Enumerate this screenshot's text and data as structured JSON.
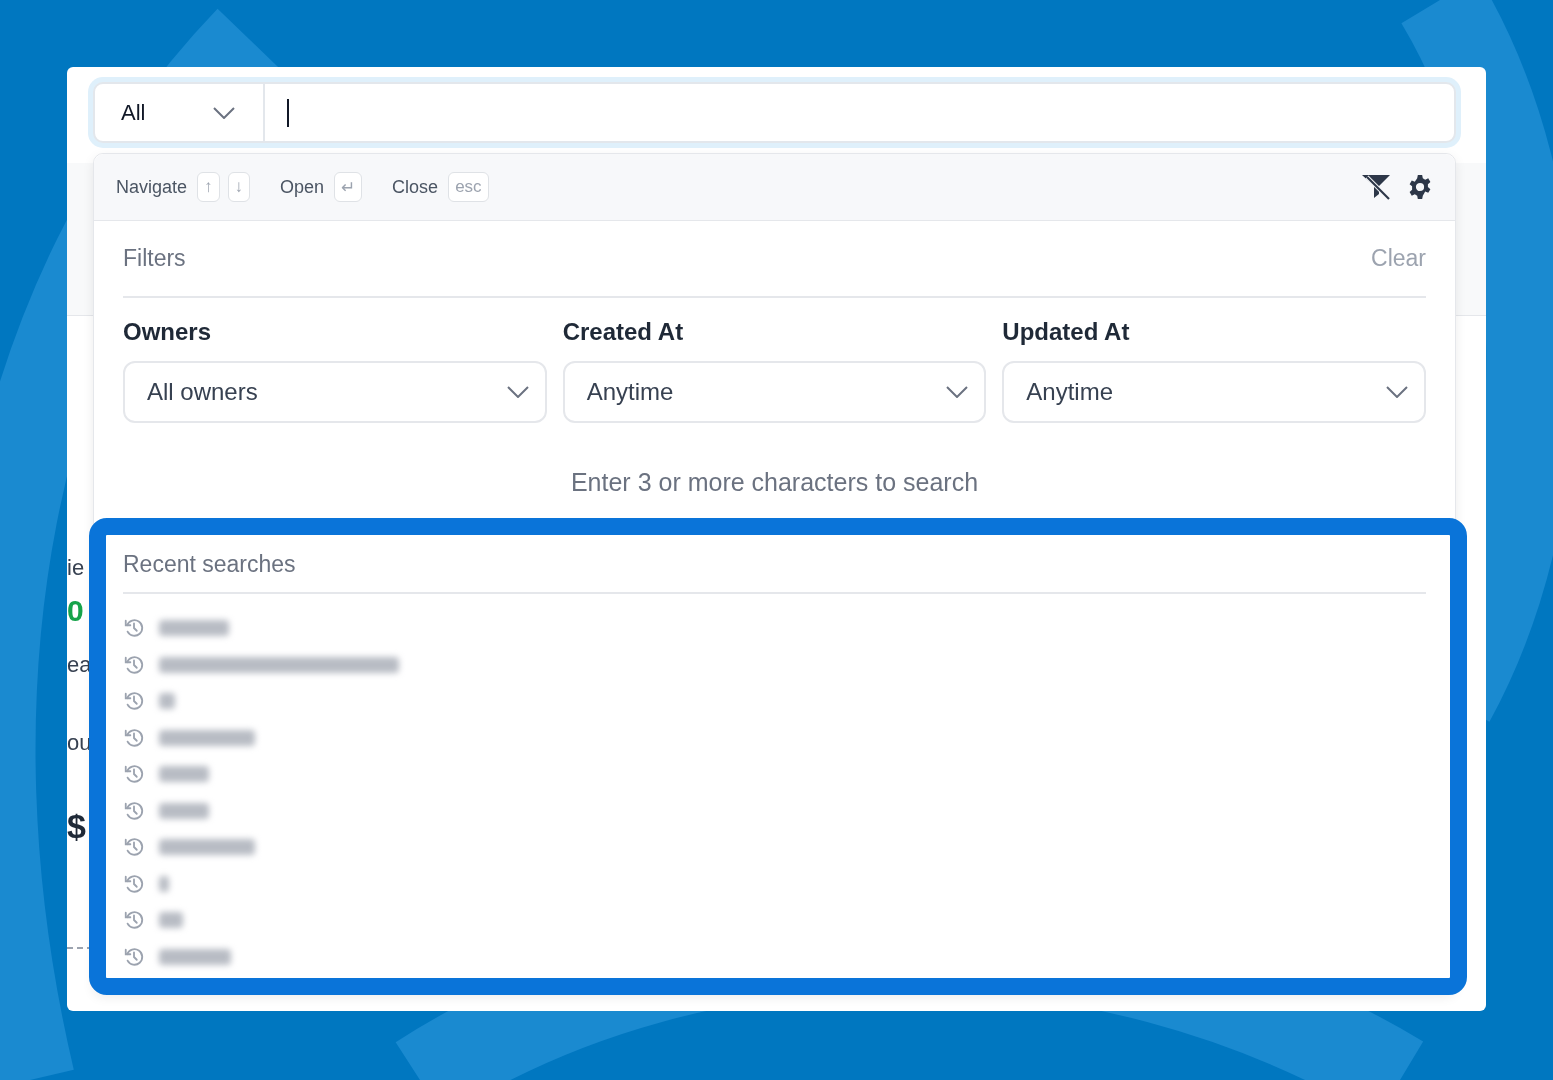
{
  "search": {
    "scope": "All"
  },
  "hints": [
    {
      "label": "Navigate",
      "keys": [
        "↑",
        "↓"
      ]
    },
    {
      "label": "Open",
      "keys": [
        "↵"
      ]
    },
    {
      "label": "Close",
      "keys": [
        "esc"
      ]
    }
  ],
  "filters": {
    "title": "Filters",
    "clear": "Clear",
    "fields": [
      {
        "label": "Owners",
        "value": "All owners"
      },
      {
        "label": "Created At",
        "value": "Anytime"
      },
      {
        "label": "Updated At",
        "value": "Anytime"
      }
    ]
  },
  "status_message": "Enter 3 or more characters to search",
  "recent_searches": {
    "title": "Recent searches",
    "highlighted": true,
    "items": [
      {
        "kind": "redacted"
      },
      {
        "kind": "redacted"
      },
      {
        "kind": "redacted"
      },
      {
        "kind": "redacted"
      },
      {
        "kind": "redacted"
      },
      {
        "kind": "redacted"
      },
      {
        "kind": "redacted"
      },
      {
        "kind": "redacted"
      },
      {
        "kind": "redacted"
      },
      {
        "kind": "redacted"
      }
    ]
  },
  "background_fragments": [
    {
      "text": "ie",
      "kind": "label"
    },
    {
      "text": "0",
      "kind": "metric"
    },
    {
      "text": "ea",
      "kind": "label"
    },
    {
      "text": "ou",
      "kind": "label"
    },
    {
      "text": "$",
      "kind": "amount"
    }
  ]
}
